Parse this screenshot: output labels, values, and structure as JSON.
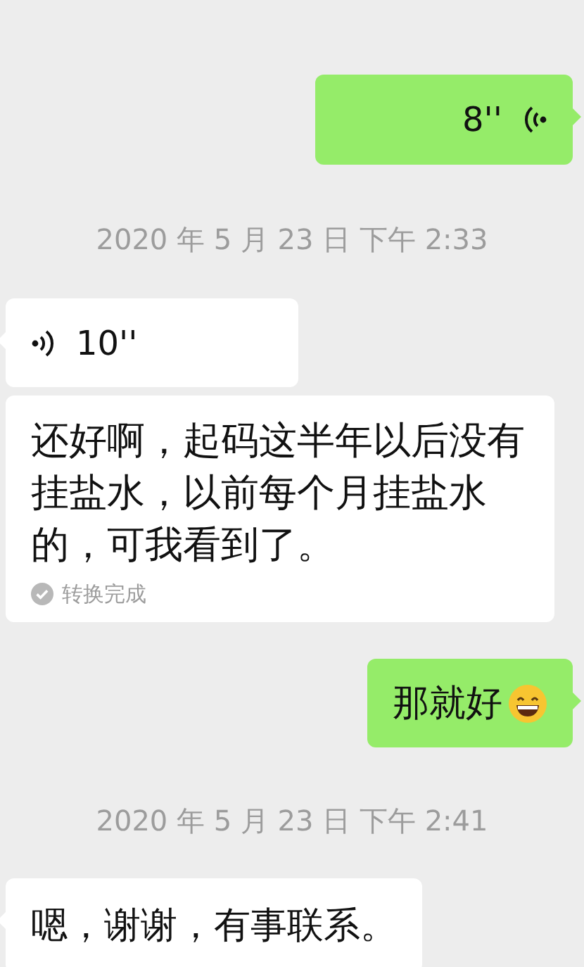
{
  "messages": [
    {
      "kind": "voice",
      "outgoing": true,
      "duration": "8''"
    },
    {
      "kind": "timestamp",
      "text": "2020 年 5 月 23 日 下午 2:33"
    },
    {
      "kind": "voice",
      "outgoing": false,
      "duration": "10''"
    },
    {
      "kind": "transcript",
      "outgoing": false,
      "text": "还好啊，起码这半年以后没有挂盐水，以前每个月挂盐水的，可我看到了。",
      "status": "转换完成"
    },
    {
      "kind": "text",
      "outgoing": true,
      "text": "那就好",
      "emoji": true
    },
    {
      "kind": "timestamp",
      "text": "2020 年 5 月 23 日 下午 2:41"
    },
    {
      "kind": "text",
      "outgoing": false,
      "text": "嗯，谢谢，有事联系。",
      "emoji": false
    }
  ]
}
